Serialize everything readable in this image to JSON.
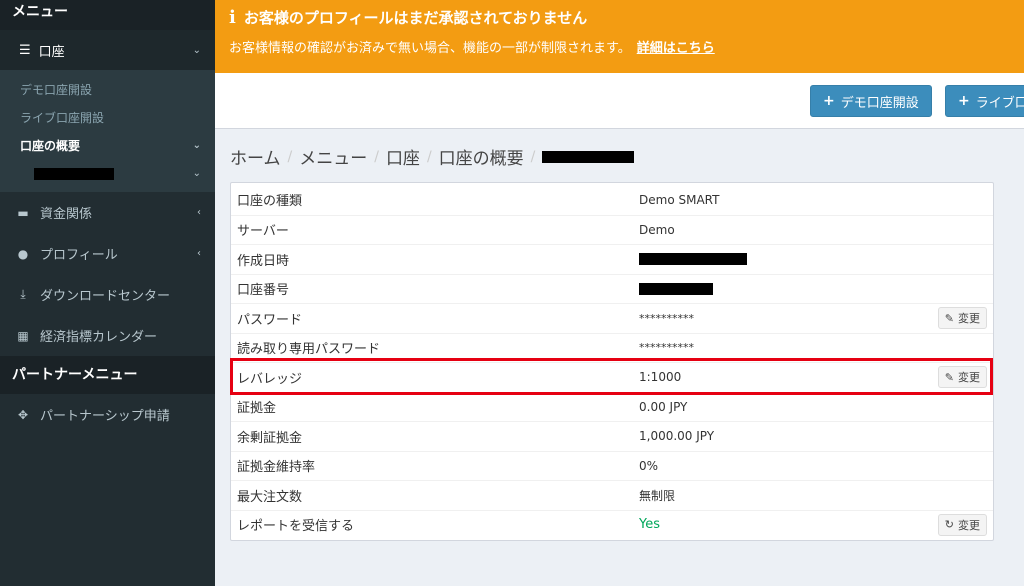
{
  "sidebar": {
    "menu_header": "メニュー",
    "account_label": "口座",
    "sub_items": [
      "デモ口座開設",
      "ライブ口座開設",
      "口座の概要"
    ],
    "items": [
      {
        "label": "資金関係",
        "icon": "wallet-icon"
      },
      {
        "label": "プロフィール",
        "icon": "user-icon"
      },
      {
        "label": "ダウンロードセンター",
        "icon": "download-icon"
      },
      {
        "label": "経済指標カレンダー",
        "icon": "calendar-icon"
      }
    ],
    "partner_header": "パートナーメニュー",
    "partner_item": "パートナーシップ申請"
  },
  "alert": {
    "title": "お客様のプロフィールはまだ承認されておりません",
    "body": "お客様情報の確認がお済みで無い場合、機能の一部が制限されます。",
    "link": "詳細はこちら"
  },
  "toolbar": {
    "demo_button": "デモ口座開設",
    "live_button": "ライブ口"
  },
  "breadcrumb": [
    "ホーム",
    "メニュー",
    "口座",
    "口座の概要"
  ],
  "table": {
    "rows": [
      {
        "key": "口座の種類",
        "value": "Demo SMART"
      },
      {
        "key": "サーバー",
        "value": "Demo"
      },
      {
        "key": "作成日時",
        "value": ""
      },
      {
        "key": "口座番号",
        "value": ""
      },
      {
        "key": "パスワード",
        "value": "**********"
      },
      {
        "key": "読み取り専用パスワード",
        "value": "**********"
      },
      {
        "key": "レバレッジ",
        "value": "1:1000"
      },
      {
        "key": "証拠金",
        "value": "0.00 JPY"
      },
      {
        "key": "余剰証拠金",
        "value": "1,000.00 JPY"
      },
      {
        "key": "証拠金維持率",
        "value": "0%"
      },
      {
        "key": "最大注文数",
        "value": "無制限"
      },
      {
        "key": "レポートを受信する",
        "value": "Yes"
      }
    ],
    "change_label": "変更"
  },
  "colors": {
    "alert_bg": "#f39c12",
    "sidebar_bg": "#222d32",
    "primary": "#3c8dbc",
    "highlight": "#e60012",
    "yes_green": "#00a65a"
  }
}
